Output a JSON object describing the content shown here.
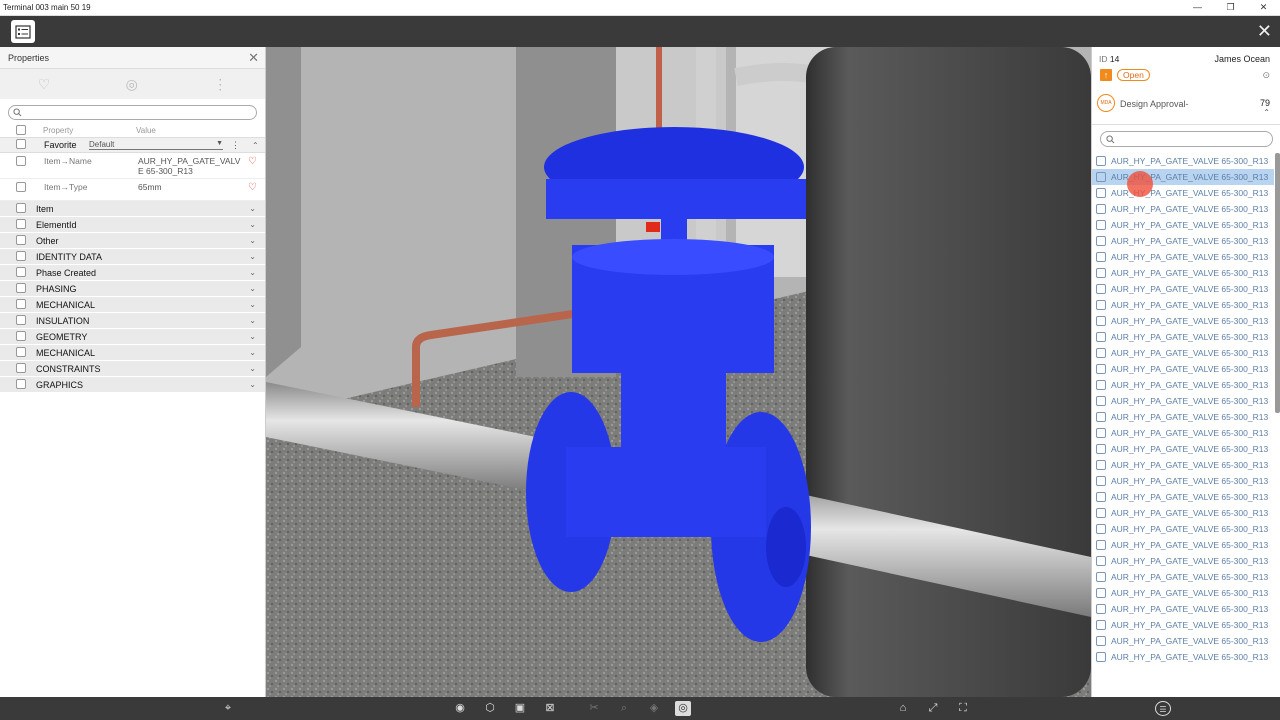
{
  "window": {
    "title": "Terminal 003 main 50 19"
  },
  "properties": {
    "title": "Properties",
    "col_property": "Property",
    "col_value": "Value",
    "favorite": {
      "label": "Favorite",
      "dropdown": "Default"
    },
    "rows": [
      {
        "name": "Item→Name",
        "value": "AUR_HY_PA_GATE_VALV\nE 65-300_R13"
      },
      {
        "name": "Item→Type",
        "value": "65mm"
      }
    ],
    "sections": [
      "Item",
      "ElementId",
      "Other",
      "IDENTITY DATA",
      "Phase Created",
      "PHASING",
      "MECHANICAL",
      "INSULATION",
      "GEOMETRY",
      "MECHANICAL",
      "CONSTRAINTS",
      "GRAPHICS"
    ]
  },
  "issue": {
    "id_label": "ID",
    "id": "14",
    "user": "James Ocean",
    "status": "Open",
    "avatar_text": "MDA",
    "approval": "Design Approval-",
    "count": "79"
  },
  "elements": {
    "items": [
      "AUR_HY_PA_GATE_VALVE 65-300_R13",
      "AUR_HY_PA_GATE_VALVE 65-300_R13",
      "AUR_HY_PA_GATE_VALVE 65-300_R13",
      "AUR_HY_PA_GATE_VALVE 65-300_R13",
      "AUR_HY_PA_GATE_VALVE 65-300_R13",
      "AUR_HY_PA_GATE_VALVE 65-300_R13",
      "AUR_HY_PA_GATE_VALVE 65-300_R13",
      "AUR_HY_PA_GATE_VALVE 65-300_R13",
      "AUR_HY_PA_GATE_VALVE 65-300_R13",
      "AUR_HY_PA_GATE_VALVE 65-300_R13",
      "AUR_HY_PA_GATE_VALVE 65-300_R13",
      "AUR_HY_PA_GATE_VALVE 65-300_R13",
      "AUR_HY_PA_GATE_VALVE 65-300_R13",
      "AUR_HY_PA_GATE_VALVE 65-300_R13",
      "AUR_HY_PA_GATE_VALVE 65-300_R13",
      "AUR_HY_PA_GATE_VALVE 65-300_R13",
      "AUR_HY_PA_GATE_VALVE 65-300_R13",
      "AUR_HY_PA_GATE_VALVE 65-300_R13",
      "AUR_HY_PA_GATE_VALVE 65-300_R13",
      "AUR_HY_PA_GATE_VALVE 65-300_R13",
      "AUR_HY_PA_GATE_VALVE 65-300_R13",
      "AUR_HY_PA_GATE_VALVE 65-300_R13",
      "AUR_HY_PA_GATE_VALVE 65-300_R13",
      "AUR_HY_PA_GATE_VALVE 65-300_R13",
      "AUR_HY_PA_GATE_VALVE 65-300_R13",
      "AUR_HY_PA_GATE_VALVE 65-300_R13",
      "AUR_HY_PA_GATE_VALVE 65-300_R13",
      "AUR_HY_PA_GATE_VALVE 65-300_R13",
      "AUR_HY_PA_GATE_VALVE 65-300_R13",
      "AUR_HY_PA_GATE_VALVE 65-300_R13",
      "AUR_HY_PA_GATE_VALVE 65-300_R13",
      "AUR_HY_PA_GATE_VALVE 65-300_R13"
    ],
    "selected_index": 1
  },
  "colors": {
    "valve": "#2a3cf0",
    "status": "#f08a1c",
    "selection": "#b9d4f1"
  }
}
